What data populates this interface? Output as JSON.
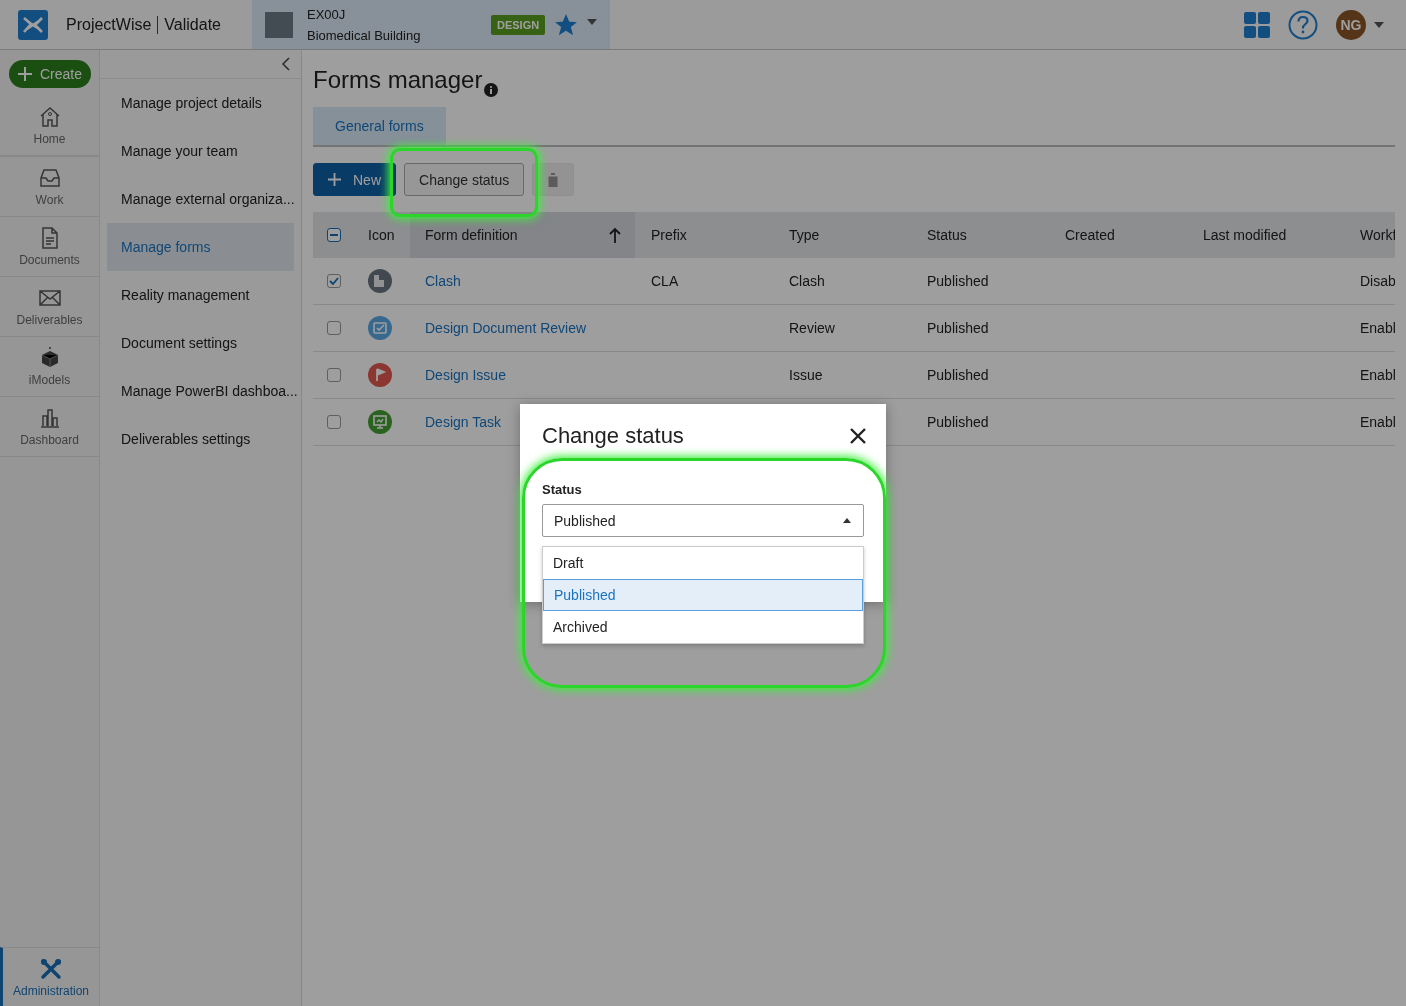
{
  "app": {
    "product": "ProjectWise",
    "module": "Validate"
  },
  "project": {
    "code": "EX00J",
    "name": "Biomedical Building",
    "badge": "DESIGN",
    "favorite": true
  },
  "user": {
    "initials": "NG"
  },
  "rail": {
    "create": "Create",
    "items": [
      {
        "label": "Home",
        "selected": false
      },
      {
        "label": "Work",
        "selected": false
      },
      {
        "label": "Documents",
        "selected": false
      },
      {
        "label": "Deliverables",
        "selected": false
      },
      {
        "label": "iModels",
        "selected": false
      },
      {
        "label": "Dashboard",
        "selected": false
      }
    ],
    "admin": {
      "label": "Administration",
      "selected": true
    }
  },
  "nav": {
    "items": [
      {
        "label": "Manage project details",
        "selected": false
      },
      {
        "label": "Manage your team",
        "selected": false
      },
      {
        "label": "Manage external organiza...",
        "selected": false
      },
      {
        "label": "Manage forms",
        "selected": true
      },
      {
        "label": "Reality management",
        "selected": false
      },
      {
        "label": "Document settings",
        "selected": false
      },
      {
        "label": "Manage PowerBI dashboa...",
        "selected": false
      },
      {
        "label": "Deliverables settings",
        "selected": false
      }
    ]
  },
  "page": {
    "title": "Forms manager",
    "tabs": [
      {
        "label": "General forms",
        "selected": true
      }
    ],
    "toolbar": [
      {
        "kind": "primary",
        "label": "New"
      },
      {
        "kind": "default",
        "label": "Change status",
        "highlighted": true
      },
      {
        "kind": "delete",
        "disabled": true
      }
    ],
    "table": {
      "indeterminate": true,
      "columns": [
        {
          "label": "Icon"
        },
        {
          "label": "Form definition",
          "sorted": true
        },
        {
          "label": "Prefix"
        },
        {
          "label": "Type"
        },
        {
          "label": "Status"
        },
        {
          "label": "Created"
        },
        {
          "label": "Last modified"
        },
        {
          "label": "Workf"
        }
      ],
      "rows": [
        {
          "selected": true,
          "kind": "document",
          "definition": "Clash",
          "prefix": "CLA",
          "type": "Clash",
          "status": "Published",
          "workflow": "Disab"
        },
        {
          "selected": false,
          "kind": "check",
          "definition": "Design Document Review",
          "type": "Review",
          "status": "Published",
          "workflow": "Enabl"
        },
        {
          "selected": false,
          "kind": "flag",
          "definition": "Design Issue",
          "type": "Issue",
          "status": "Published",
          "workflow": "Enabl"
        },
        {
          "selected": false,
          "kind": "screen",
          "definition": "Design Task",
          "status": "Published",
          "workflow": "Enabl"
        }
      ]
    }
  },
  "dialog": {
    "title": "Change status",
    "field_label": "Status",
    "value": "Published",
    "highlighted": true,
    "expanded": true,
    "options": [
      {
        "label": "Draft",
        "selected": false
      },
      {
        "label": "Published",
        "selected": true
      },
      {
        "label": "Archived",
        "selected": false
      }
    ]
  }
}
